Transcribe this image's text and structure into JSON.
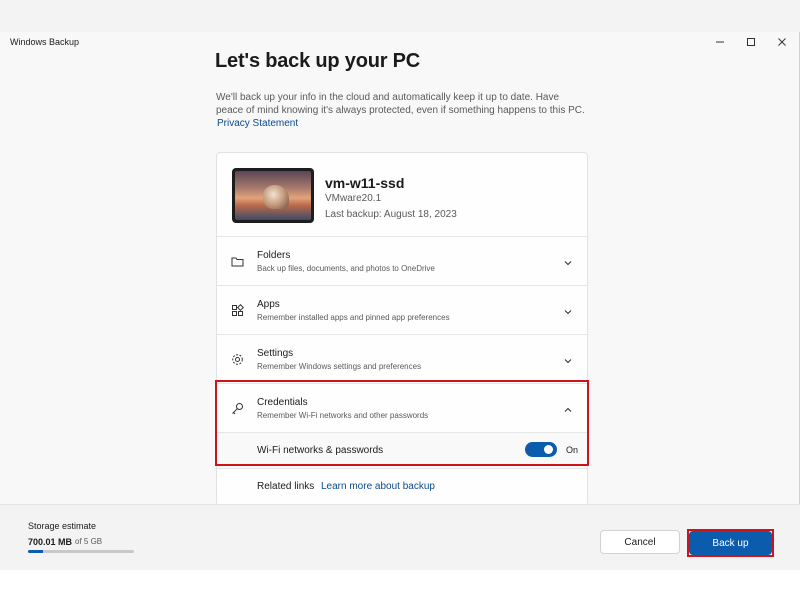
{
  "window": {
    "title": "Windows Backup",
    "controls": {
      "minimize_icon": "minimize-icon",
      "maximize_icon": "maximize-icon",
      "close_icon": "close-icon"
    }
  },
  "header": {
    "title": "Let's back up your PC",
    "intro": "We'll back up your info in the cloud and automatically keep it up to date. Have peace of mind knowing it's always protected, even if something happens to this PC.",
    "privacy_link": "Privacy Statement"
  },
  "device": {
    "name": "vm-w11-ssd",
    "model": "VMware20.1",
    "last_backup": "Last backup: August 18, 2023"
  },
  "sections": [
    {
      "label": "Folders",
      "description": "Back up files, documents, and photos to OneDrive",
      "icon": "folder-icon",
      "expanded": false
    },
    {
      "label": "Apps",
      "description": "Remember installed apps and pinned app preferences",
      "icon": "apps-icon",
      "expanded": false
    },
    {
      "label": "Settings",
      "description": "Remember Windows settings and preferences",
      "icon": "gear-icon",
      "expanded": false
    },
    {
      "label": "Credentials",
      "description": "Remember Wi-Fi networks and other passwords",
      "icon": "key-icon",
      "expanded": true
    }
  ],
  "credentials_option": {
    "label": "Wi-Fi networks & passwords",
    "toggle_state": "On",
    "enabled": true
  },
  "related": {
    "label": "Related links",
    "link": "Learn more about backup"
  },
  "footer": {
    "storage_title": "Storage estimate",
    "storage_used": "700.01 MB",
    "storage_total": "of 5 GB",
    "storage_fraction": 0.14,
    "cancel_label": "Cancel",
    "backup_label": "Back up"
  },
  "colors": {
    "accent": "#0b5cad",
    "highlight": "#d0131b",
    "link": "#0a4a8c"
  }
}
